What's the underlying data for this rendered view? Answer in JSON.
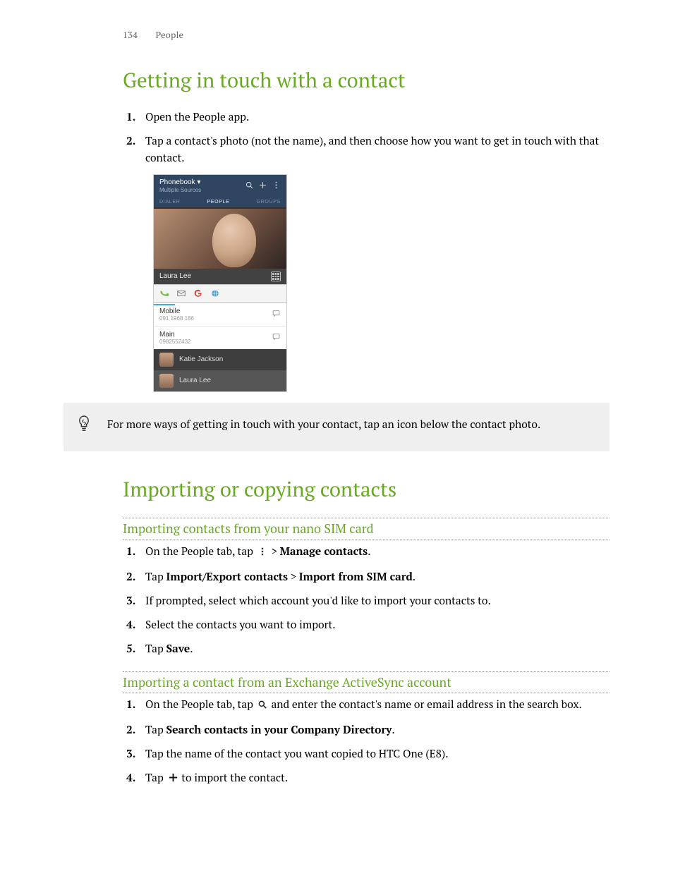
{
  "header": {
    "page_number": "134",
    "section": "People"
  },
  "sec1": {
    "title": "Getting in touch with a contact",
    "steps": [
      "Open the People app.",
      "Tap a contact's photo (not the name), and then choose how you want to get in touch with that contact."
    ]
  },
  "shot": {
    "title": "Phonebook",
    "title_chevron": "▾",
    "subtitle": "Multiple Sources",
    "tabs": [
      "DIALER",
      "PEOPLE",
      "GROUPS"
    ],
    "caption": "",
    "contact_name": "Laura Lee",
    "icons": [
      "phone",
      "mail",
      "google",
      "globe"
    ],
    "entries": [
      {
        "label": "Mobile",
        "number": "091 1968 186"
      },
      {
        "label": "Main",
        "number": "0982552432"
      }
    ],
    "rows": [
      {
        "name": "Katie Jackson"
      },
      {
        "name": "Laura Lee"
      }
    ]
  },
  "tip": {
    "text": "For more ways of getting in touch with your contact, tap an icon below the contact photo."
  },
  "sec2": {
    "title": "Importing or copying contacts"
  },
  "sub1": {
    "title": "Importing contacts from your nano SIM card",
    "s1_a": "On the People tab, tap ",
    "s1_b": " > ",
    "s1_bold1": "Manage contacts",
    "s1_c": ".",
    "s2_a": "Tap ",
    "s2_bold1": "Import/Export contacts",
    "s2_b": " > ",
    "s2_bold2": "Import from SIM card",
    "s2_c": ".",
    "s3": "If prompted, select which account you'd like to import your contacts to.",
    "s4": "Select the contacts you want to import.",
    "s5_a": "Tap ",
    "s5_bold": "Save",
    "s5_b": "."
  },
  "sub2": {
    "title": "Importing a contact from an Exchange ActiveSync account",
    "s1_a": "On the People tab, tap ",
    "s1_b": " and enter the contact's name or email address in the search box.",
    "s2_a": "Tap ",
    "s2_bold": "Search contacts in your Company Directory",
    "s2_b": ".",
    "s3": "Tap the name of the contact you want copied to HTC One (E8).",
    "s4_a": "Tap ",
    "s4_b": " to import the contact."
  }
}
